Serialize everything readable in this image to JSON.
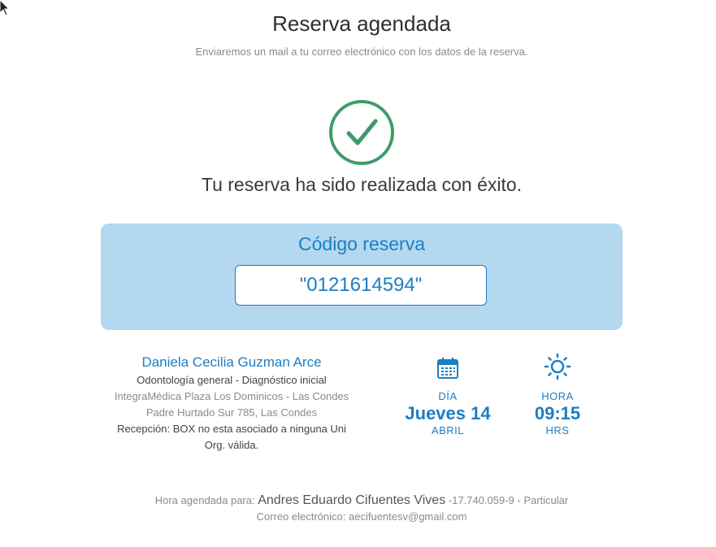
{
  "header": {
    "title": "Reserva agendada",
    "subtitle": "Enviaremos un mail a tu correo electrónico con los datos de la reserva."
  },
  "confirmation": {
    "message": "Tu reserva ha sido realizada con éxito.",
    "icon": "check-circle-icon",
    "color": "#3f9b6b"
  },
  "reservation_code": {
    "label": "Código reserva",
    "value": "\"0121614594\""
  },
  "appointment": {
    "doctor": "Daniela Cecilia Guzman Arce",
    "specialty": "Odontología general - Diagnóstico inicial",
    "location": "IntegraMédica Plaza Los Dominicos - Las Condes",
    "address": "Padre Hurtado Sur 785, Las Condes",
    "reception": "Recepción: BOX no esta asociado a ninguna Uni Org. válida."
  },
  "date": {
    "icon": "calendar-icon",
    "label": "DÍA",
    "value": "Jueves 14",
    "month": "ABRIL"
  },
  "time": {
    "icon": "sun-icon",
    "label": "HORA",
    "value": "09:15",
    "unit": "HRS"
  },
  "patient": {
    "prefix": "Hora agendada para:",
    "name": "Andres Eduardo Cifuentes Vives",
    "rut": "-17.740.059-9",
    "plan": " - Particular",
    "email_label": "Correo electrónico:",
    "email": "aecifuentesv@gmail.com"
  },
  "colors": {
    "accent": "#1d7ec2",
    "code_background": "#b3d8f0",
    "success": "#3f9b6b"
  }
}
